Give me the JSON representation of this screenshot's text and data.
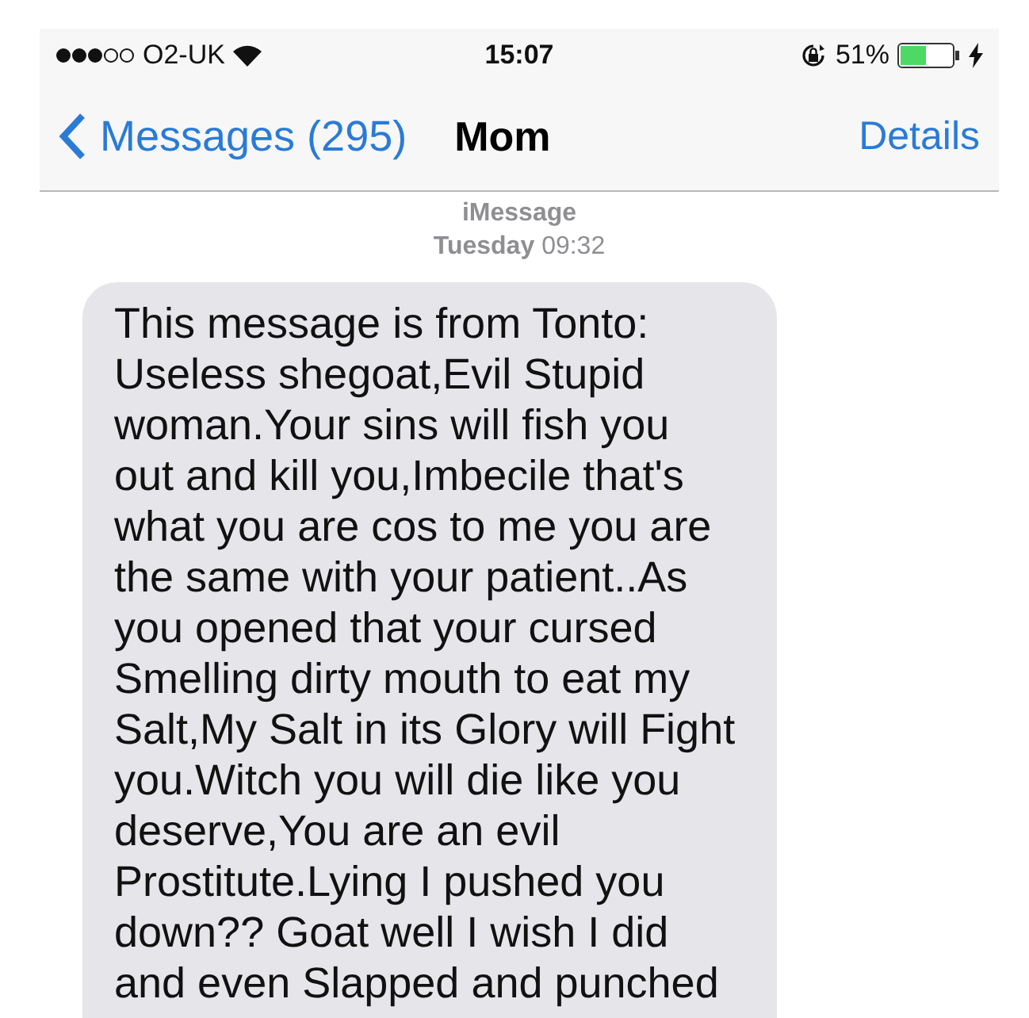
{
  "status_bar": {
    "carrier": "O2-UK",
    "time": "15:07",
    "battery_percent": "51%"
  },
  "nav_bar": {
    "back_label": "Messages (295)",
    "title": "Mom",
    "action": "Details"
  },
  "thread_header": {
    "service": "iMessage",
    "day": "Tuesday",
    "time": "09:32"
  },
  "messages": [
    {
      "lines": [
        "This message is from Tonto:",
        "Useless shegoat,Evil Stupid",
        "woman.Your sins will fish you",
        "out and kill you,Imbecile that's",
        "what you are cos to me you are",
        "the same with your patient..As",
        "you opened that your cursed",
        "Smelling dirty mouth to eat my",
        "Salt,My Salt in its Glory will Fight",
        "you.Witch you will die like you",
        "deserve,You are an evil",
        "Prostitute.Lying I pushed you",
        "down?? Goat well I wish I did",
        "and even Slapped and punched"
      ]
    }
  ]
}
